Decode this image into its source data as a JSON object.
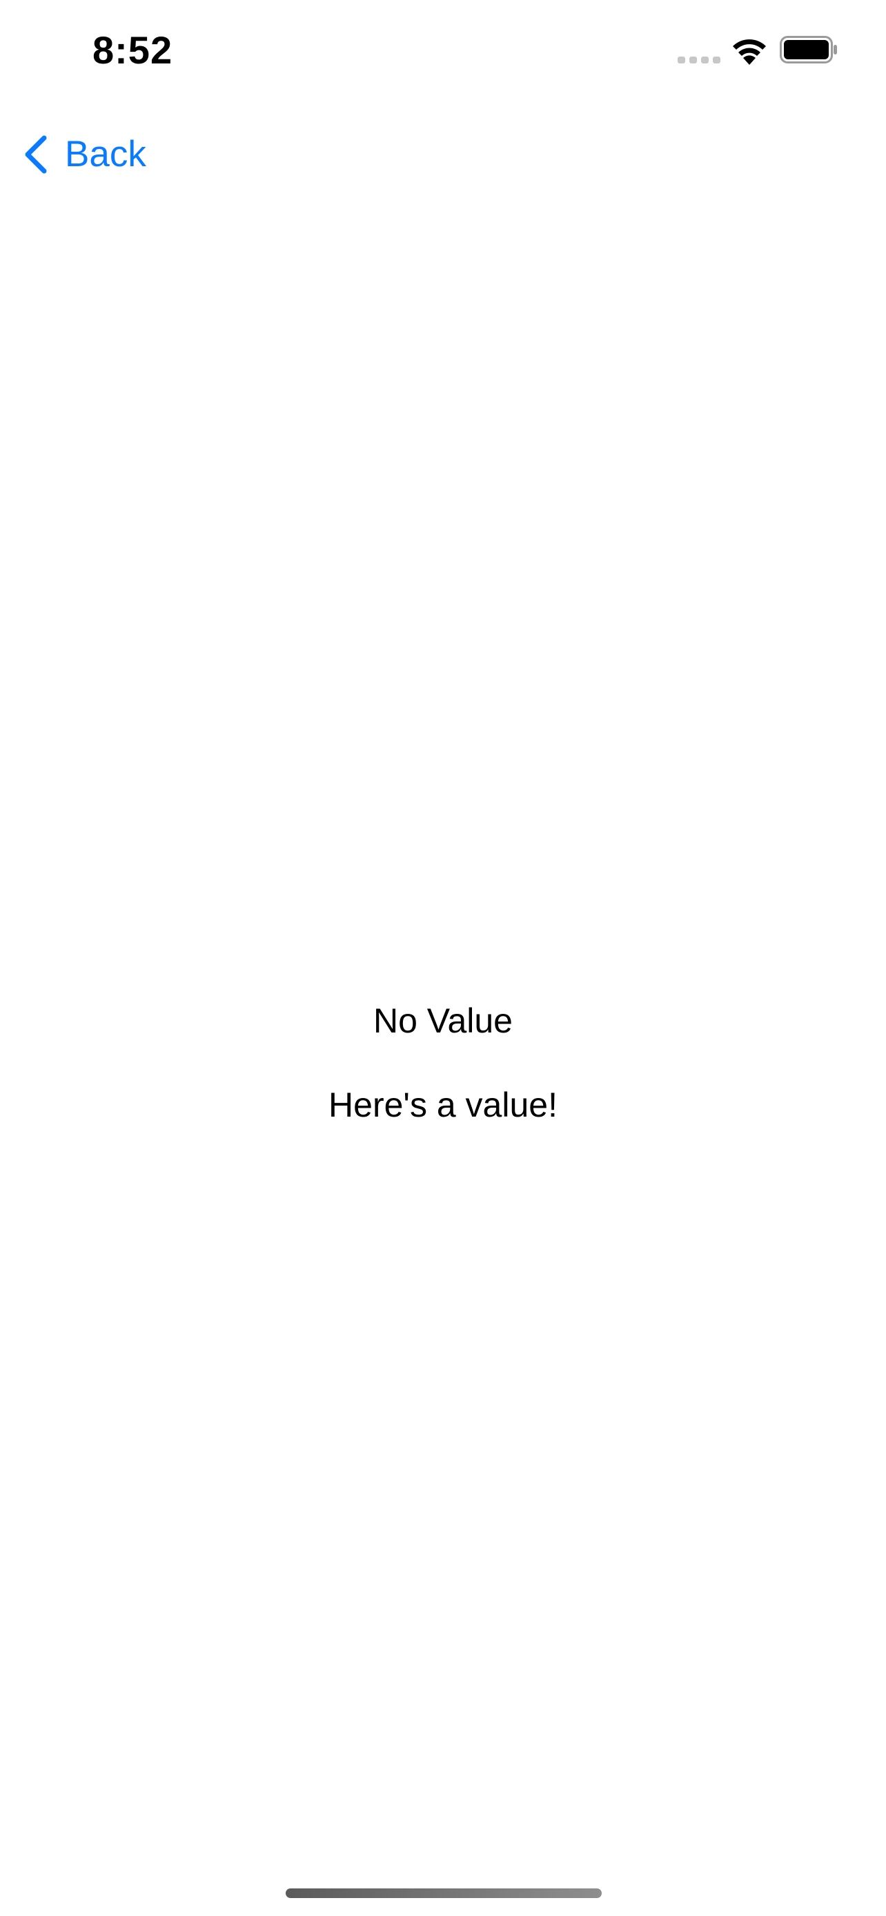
{
  "status_bar": {
    "time": "8:52",
    "signal_icon": "cellular-signal-icon",
    "wifi_icon": "wifi-icon",
    "battery_icon": "battery-icon"
  },
  "nav": {
    "back_label": "Back",
    "back_icon": "chevron-left-icon",
    "accent_color": "#0a7bff"
  },
  "content": {
    "first_text": "No Value",
    "second_text": "Here's a value!"
  }
}
